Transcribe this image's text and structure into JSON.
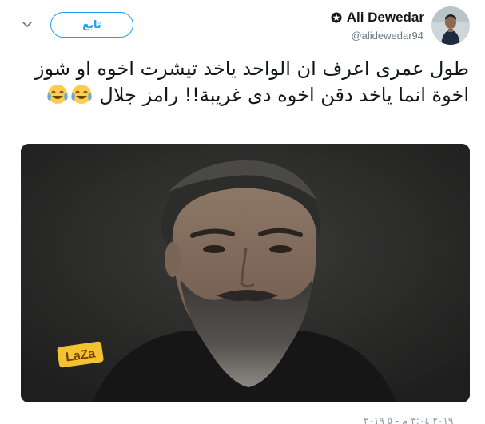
{
  "header": {
    "display_name": "Ali Dewedar",
    "handle": "@alidewedar94",
    "follow_label": "تابع"
  },
  "tweet": {
    "text": "طول عمرى اعرف ان الواحد ياخد تيشرت اخوه او شوز اخوة انما ياخد دقن اخوه دى غريبة!! رامز جلال",
    "emoji": [
      "face-with-tears-of-joy",
      "face-with-tears-of-joy"
    ]
  },
  "media": {
    "logo_text": "LaZa"
  },
  "footer": {
    "timestamp": "٢٠١٩ ٣:٠٤ م - ٥ ٢٠١٩"
  },
  "colors": {
    "accent": "#1da1f2",
    "text": "#14171a",
    "secondary": "#657786"
  }
}
